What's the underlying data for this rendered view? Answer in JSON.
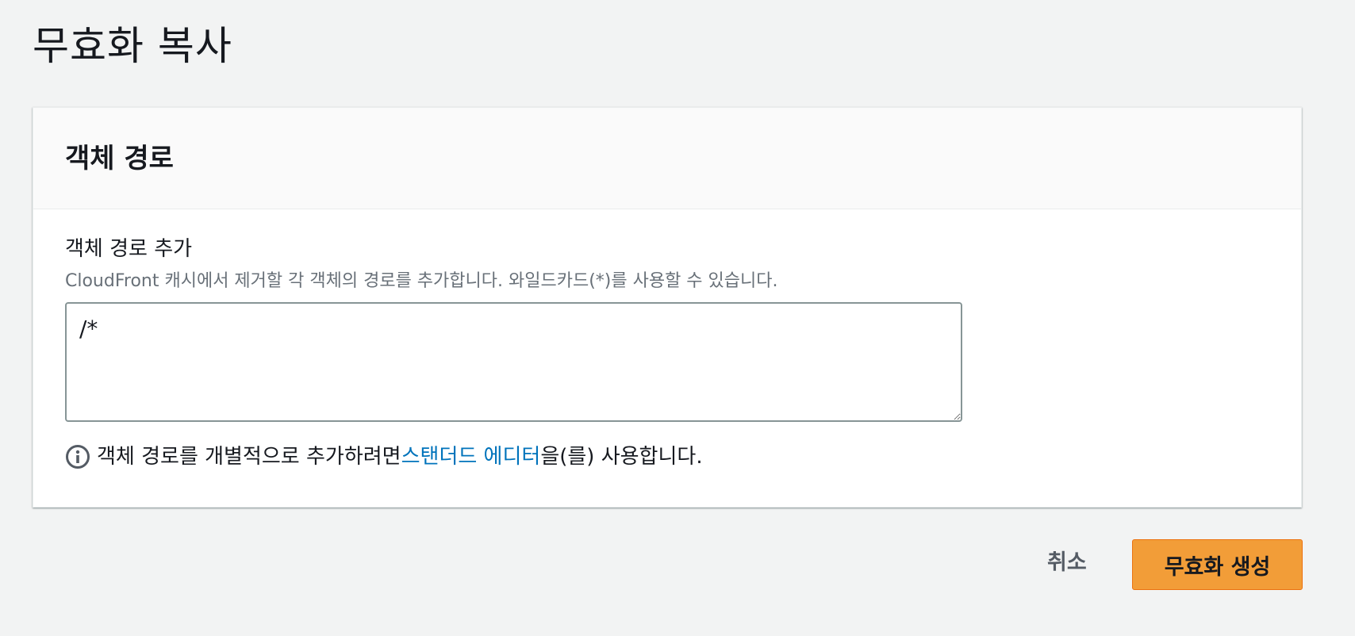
{
  "page": {
    "title": "무효화 복사"
  },
  "panel": {
    "title": "객체 경로",
    "field_label": "객체 경로 추가",
    "field_description": "CloudFront 캐시에서 제거할 각 객체의 경로를 추가합니다. 와일드카드(*)를 사용할 수 있습니다.",
    "textarea_value": "/*",
    "info": {
      "icon": "info-icon",
      "text_before": "객체 경로를 개별적으로 추가하려면 ",
      "link_label": "스탠더드 에디터",
      "text_after": "을(를) 사용합니다."
    }
  },
  "actions": {
    "cancel_label": "취소",
    "create_label": "무효화 생성"
  },
  "colors": {
    "accent_button": "#f29d38",
    "link": "#0073bb",
    "background": "#f2f3f3"
  }
}
